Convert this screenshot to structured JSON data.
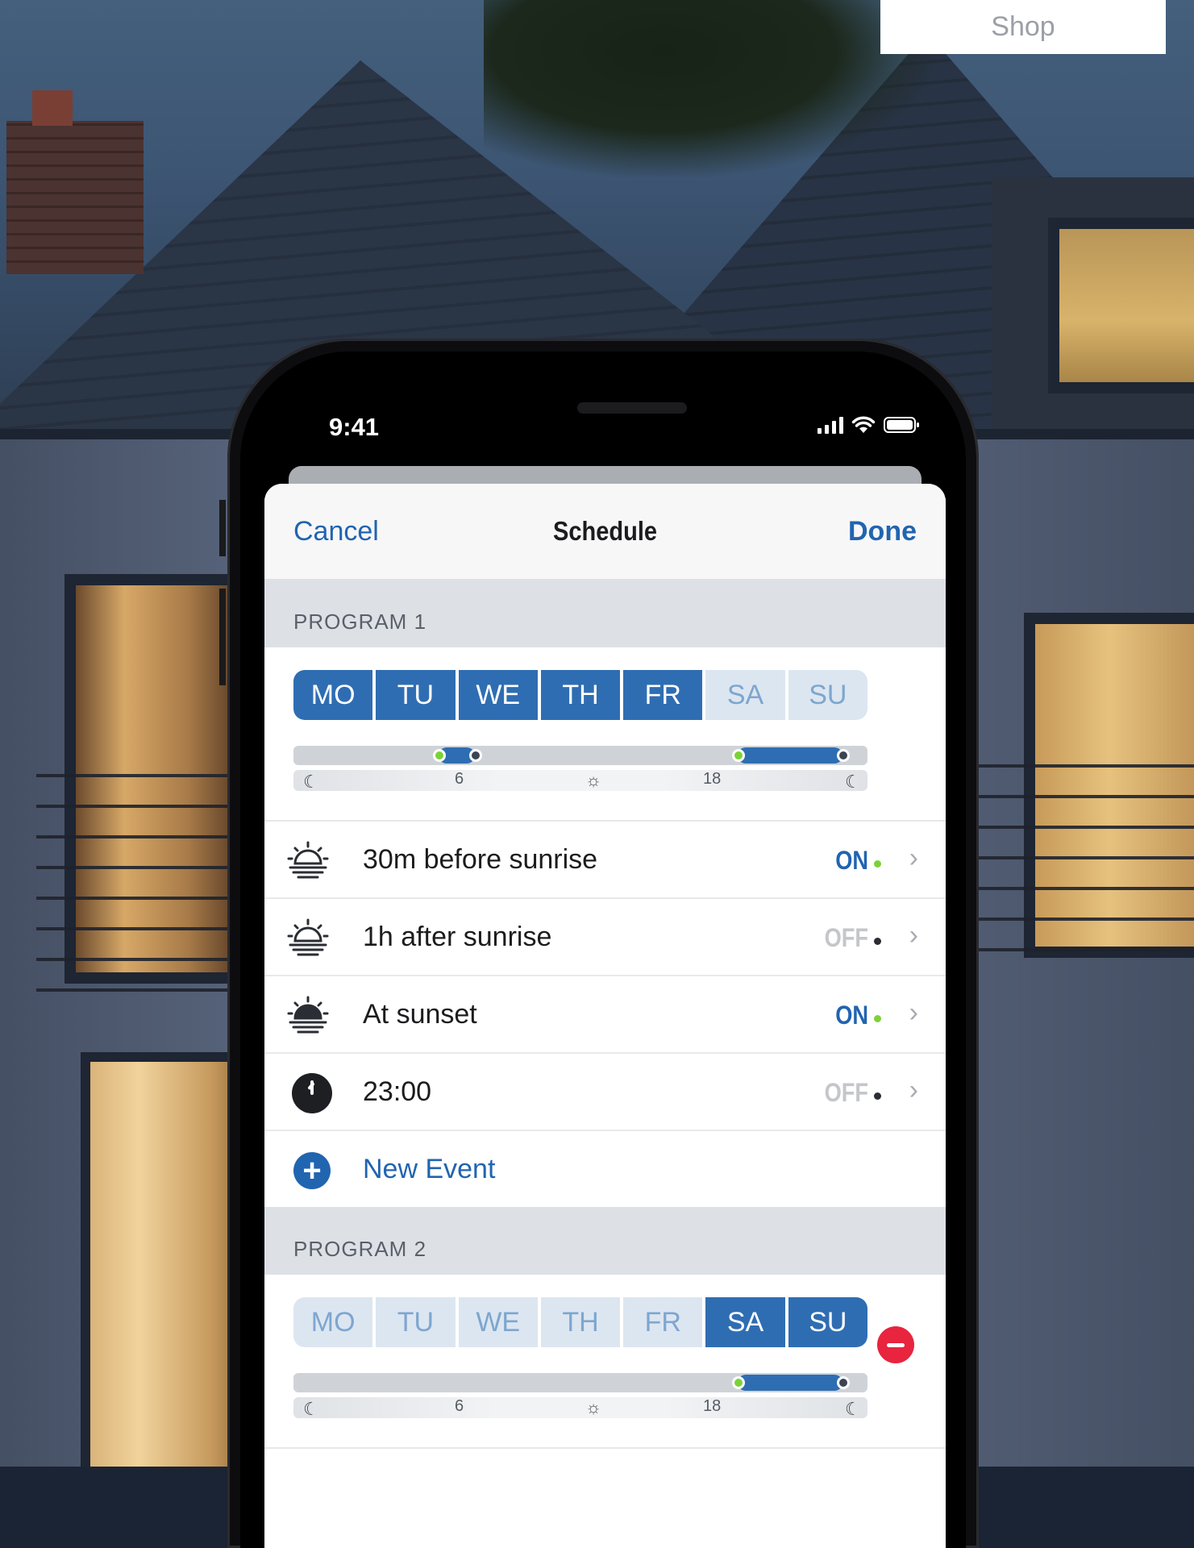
{
  "shop_tab": {
    "label": "Shop"
  },
  "status_bar": {
    "time": "9:41"
  },
  "nav": {
    "cancel": "Cancel",
    "title": "Schedule",
    "done": "Done"
  },
  "programs": [
    {
      "header": "PROGRAM 1",
      "days": [
        {
          "label": "MO",
          "active": true
        },
        {
          "label": "TU",
          "active": true
        },
        {
          "label": "WE",
          "active": true
        },
        {
          "label": "TH",
          "active": true
        },
        {
          "label": "FR",
          "active": true
        },
        {
          "label": "SA",
          "active": false
        },
        {
          "label": "SU",
          "active": false
        }
      ],
      "timeline_ticks": [
        "6",
        "18"
      ],
      "events": [
        {
          "icon": "sunrise-icon",
          "label": "30m before sunrise",
          "state": "ON"
        },
        {
          "icon": "sunrise-icon",
          "label": "1h after sunrise",
          "state": "OFF"
        },
        {
          "icon": "sunset-icon",
          "label": "At sunset",
          "state": "ON"
        },
        {
          "icon": "clock-icon",
          "label": "23:00",
          "state": "OFF"
        }
      ],
      "new_event_label": "New Event"
    },
    {
      "header": "PROGRAM 2",
      "days": [
        {
          "label": "MO",
          "active": false
        },
        {
          "label": "TU",
          "active": false
        },
        {
          "label": "WE",
          "active": false
        },
        {
          "label": "TH",
          "active": false
        },
        {
          "label": "FR",
          "active": false
        },
        {
          "label": "SA",
          "active": true
        },
        {
          "label": "SU",
          "active": true
        }
      ],
      "timeline_ticks": [
        "6",
        "18"
      ]
    }
  ],
  "colors": {
    "accent": "#2164b0",
    "day_active": "#2f6db3",
    "day_inactive": "#dce6f1",
    "on_dot": "#7bd238",
    "remove": "#e8243f"
  }
}
